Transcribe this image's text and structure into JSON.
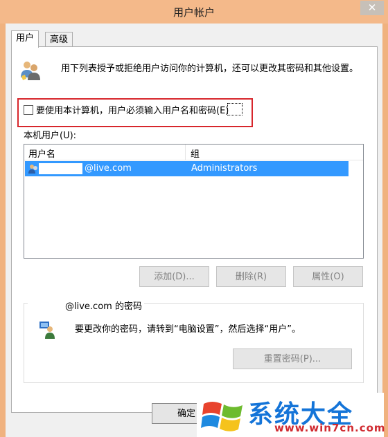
{
  "window": {
    "title": "用户帐户",
    "close_label": "✕"
  },
  "tabs": [
    {
      "label": "用户"
    },
    {
      "label": "高级"
    }
  ],
  "intro": {
    "text": "用下列表授予或拒绝用户访问你的计算机，还可以更改其密码和其他设置。"
  },
  "require_login": {
    "label": "要使用本计算机，用户必须输入用户名和密码(E)",
    "checked": false
  },
  "users_list": {
    "label": "本机用户(U):",
    "columns": [
      "用户名",
      "组"
    ],
    "rows": [
      {
        "user": "@live.com",
        "group": "Administrators",
        "selected": true
      }
    ]
  },
  "buttons": {
    "add": "添加(D)...",
    "remove": "删除(R)",
    "properties": "属性(O)",
    "reset_password": "重置密码(P)...",
    "ok": "确定"
  },
  "password_group": {
    "title": "@live.com 的密码",
    "text": "要更改你的密码，请转到“电脑设置”，然后选择“用户”。"
  },
  "watermark": {
    "brand": "系统大全",
    "url": "www.win7cn.com"
  },
  "colors": {
    "frame": "#f0b27f",
    "selection": "#3399ff",
    "highlight_border": "#d7262c",
    "watermark_blue": "#1474d8",
    "watermark_red": "#d0292f"
  }
}
